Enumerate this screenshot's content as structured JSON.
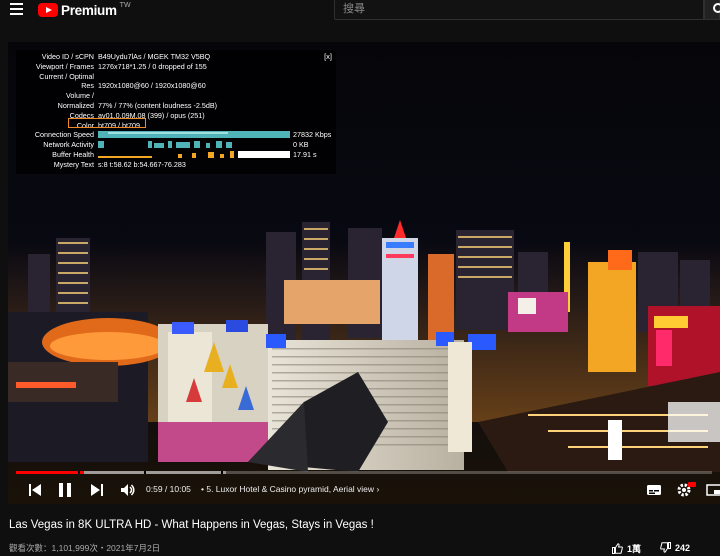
{
  "header": {
    "brand": "Premium",
    "brand_region": "TW",
    "search_placeholder": "搜尋"
  },
  "stats": {
    "close": "[x]",
    "rows": [
      {
        "k": "Video ID / sCPN",
        "v": "B49Uydu7lAs / MGEK TM32 V5BQ"
      },
      {
        "k": "Viewport / Frames",
        "v": "1276x718*1.25 / 0 dropped of 155"
      },
      {
        "k": "Current / Optimal",
        "v": ""
      },
      {
        "k": "Res",
        "v": "1920x1080@60 / 1920x1080@60"
      },
      {
        "k": "Volume /",
        "v": ""
      },
      {
        "k": "Normalized",
        "v": "77% / 77% (content loudness -2.5dB)"
      },
      {
        "k": "Codecs",
        "v": "av01.0.09M.08 (399) / opus (251)"
      },
      {
        "k": "Color",
        "v": "bt709 / bt709"
      },
      {
        "k": "Connection Speed",
        "v": "27832 Kbps"
      },
      {
        "k": "Network Activity",
        "v": "0 KB"
      },
      {
        "k": "Buffer Health",
        "v": "17.91 s"
      },
      {
        "k": "Mystery Text",
        "v": "s:8 t:58.62 b:54.667-76.283"
      }
    ]
  },
  "player": {
    "current_time": "0:59",
    "duration": "10:05",
    "time_sep": " / ",
    "chapter": "• 5. Luxor Hotel & Casino pyramid, Aerial view",
    "progress_fraction": 0.098
  },
  "video": {
    "title": "Las Vegas in 8K ULTRA HD - What Happens in Vegas, Stays in Vegas !",
    "meta": "觀看次數：1,101,999次・2021年7月2日",
    "likes": "1萬",
    "dislikes": "242"
  },
  "colors": {
    "accent": "#ff0000",
    "highlight": "#f08a24",
    "graph": "#4fb3b8"
  }
}
